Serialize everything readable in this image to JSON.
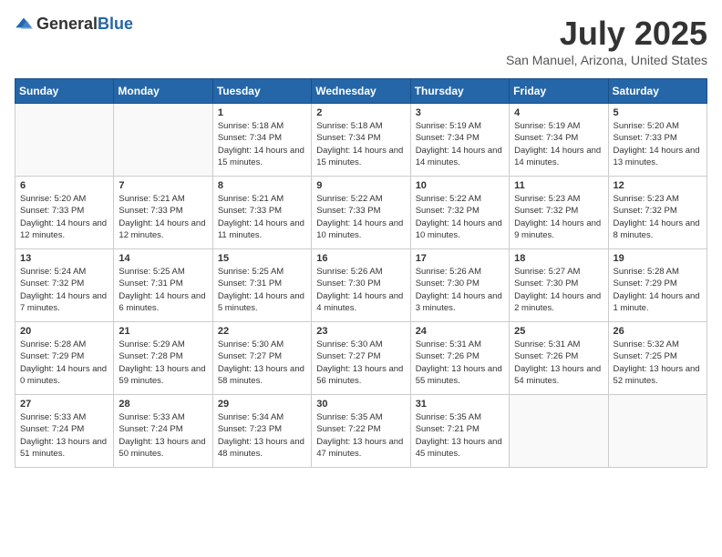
{
  "header": {
    "logo_general": "General",
    "logo_blue": "Blue",
    "month_title": "July 2025",
    "location": "San Manuel, Arizona, United States"
  },
  "weekdays": [
    "Sunday",
    "Monday",
    "Tuesday",
    "Wednesday",
    "Thursday",
    "Friday",
    "Saturday"
  ],
  "weeks": [
    [
      {
        "day": "",
        "info": ""
      },
      {
        "day": "",
        "info": ""
      },
      {
        "day": "1",
        "info": "Sunrise: 5:18 AM\nSunset: 7:34 PM\nDaylight: 14 hours and 15 minutes."
      },
      {
        "day": "2",
        "info": "Sunrise: 5:18 AM\nSunset: 7:34 PM\nDaylight: 14 hours and 15 minutes."
      },
      {
        "day": "3",
        "info": "Sunrise: 5:19 AM\nSunset: 7:34 PM\nDaylight: 14 hours and 14 minutes."
      },
      {
        "day": "4",
        "info": "Sunrise: 5:19 AM\nSunset: 7:34 PM\nDaylight: 14 hours and 14 minutes."
      },
      {
        "day": "5",
        "info": "Sunrise: 5:20 AM\nSunset: 7:33 PM\nDaylight: 14 hours and 13 minutes."
      }
    ],
    [
      {
        "day": "6",
        "info": "Sunrise: 5:20 AM\nSunset: 7:33 PM\nDaylight: 14 hours and 12 minutes."
      },
      {
        "day": "7",
        "info": "Sunrise: 5:21 AM\nSunset: 7:33 PM\nDaylight: 14 hours and 12 minutes."
      },
      {
        "day": "8",
        "info": "Sunrise: 5:21 AM\nSunset: 7:33 PM\nDaylight: 14 hours and 11 minutes."
      },
      {
        "day": "9",
        "info": "Sunrise: 5:22 AM\nSunset: 7:33 PM\nDaylight: 14 hours and 10 minutes."
      },
      {
        "day": "10",
        "info": "Sunrise: 5:22 AM\nSunset: 7:32 PM\nDaylight: 14 hours and 10 minutes."
      },
      {
        "day": "11",
        "info": "Sunrise: 5:23 AM\nSunset: 7:32 PM\nDaylight: 14 hours and 9 minutes."
      },
      {
        "day": "12",
        "info": "Sunrise: 5:23 AM\nSunset: 7:32 PM\nDaylight: 14 hours and 8 minutes."
      }
    ],
    [
      {
        "day": "13",
        "info": "Sunrise: 5:24 AM\nSunset: 7:32 PM\nDaylight: 14 hours and 7 minutes."
      },
      {
        "day": "14",
        "info": "Sunrise: 5:25 AM\nSunset: 7:31 PM\nDaylight: 14 hours and 6 minutes."
      },
      {
        "day": "15",
        "info": "Sunrise: 5:25 AM\nSunset: 7:31 PM\nDaylight: 14 hours and 5 minutes."
      },
      {
        "day": "16",
        "info": "Sunrise: 5:26 AM\nSunset: 7:30 PM\nDaylight: 14 hours and 4 minutes."
      },
      {
        "day": "17",
        "info": "Sunrise: 5:26 AM\nSunset: 7:30 PM\nDaylight: 14 hours and 3 minutes."
      },
      {
        "day": "18",
        "info": "Sunrise: 5:27 AM\nSunset: 7:30 PM\nDaylight: 14 hours and 2 minutes."
      },
      {
        "day": "19",
        "info": "Sunrise: 5:28 AM\nSunset: 7:29 PM\nDaylight: 14 hours and 1 minute."
      }
    ],
    [
      {
        "day": "20",
        "info": "Sunrise: 5:28 AM\nSunset: 7:29 PM\nDaylight: 14 hours and 0 minutes."
      },
      {
        "day": "21",
        "info": "Sunrise: 5:29 AM\nSunset: 7:28 PM\nDaylight: 13 hours and 59 minutes."
      },
      {
        "day": "22",
        "info": "Sunrise: 5:30 AM\nSunset: 7:27 PM\nDaylight: 13 hours and 58 minutes."
      },
      {
        "day": "23",
        "info": "Sunrise: 5:30 AM\nSunset: 7:27 PM\nDaylight: 13 hours and 56 minutes."
      },
      {
        "day": "24",
        "info": "Sunrise: 5:31 AM\nSunset: 7:26 PM\nDaylight: 13 hours and 55 minutes."
      },
      {
        "day": "25",
        "info": "Sunrise: 5:31 AM\nSunset: 7:26 PM\nDaylight: 13 hours and 54 minutes."
      },
      {
        "day": "26",
        "info": "Sunrise: 5:32 AM\nSunset: 7:25 PM\nDaylight: 13 hours and 52 minutes."
      }
    ],
    [
      {
        "day": "27",
        "info": "Sunrise: 5:33 AM\nSunset: 7:24 PM\nDaylight: 13 hours and 51 minutes."
      },
      {
        "day": "28",
        "info": "Sunrise: 5:33 AM\nSunset: 7:24 PM\nDaylight: 13 hours and 50 minutes."
      },
      {
        "day": "29",
        "info": "Sunrise: 5:34 AM\nSunset: 7:23 PM\nDaylight: 13 hours and 48 minutes."
      },
      {
        "day": "30",
        "info": "Sunrise: 5:35 AM\nSunset: 7:22 PM\nDaylight: 13 hours and 47 minutes."
      },
      {
        "day": "31",
        "info": "Sunrise: 5:35 AM\nSunset: 7:21 PM\nDaylight: 13 hours and 45 minutes."
      },
      {
        "day": "",
        "info": ""
      },
      {
        "day": "",
        "info": ""
      }
    ]
  ]
}
